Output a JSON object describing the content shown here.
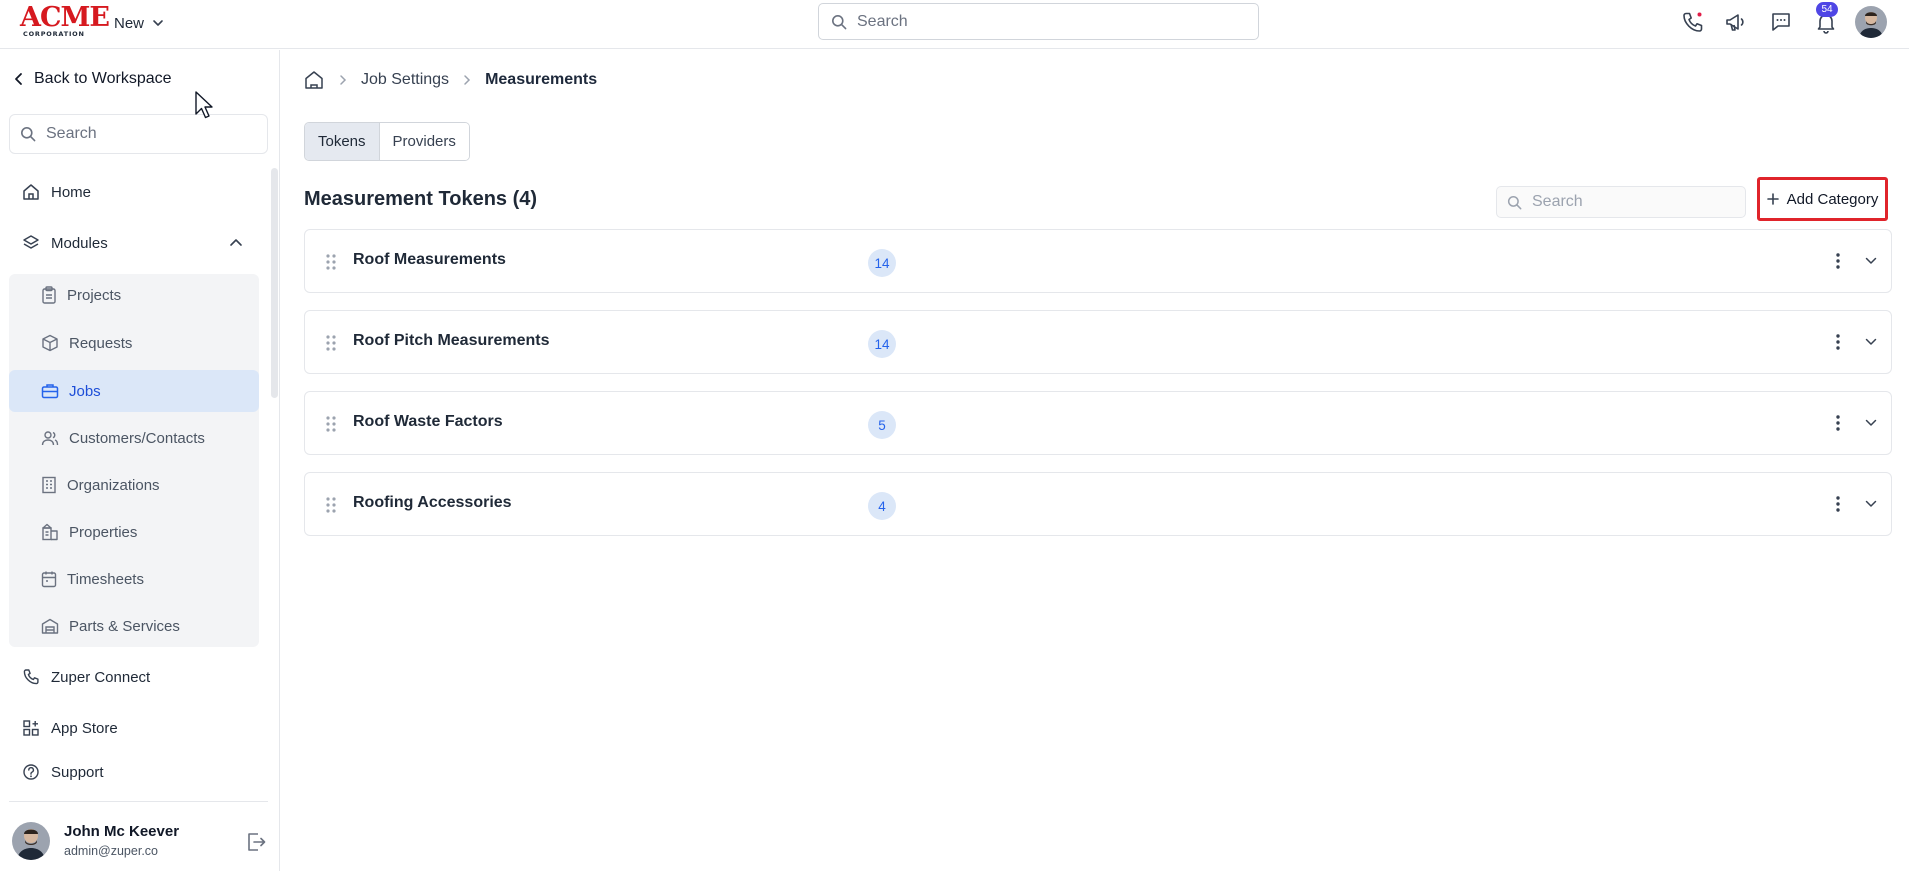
{
  "colors": {
    "accent": "#2563eb",
    "brand_red": "#d6191f",
    "highlight_border": "#e0242b",
    "active_bg": "#dbe7f8",
    "notification_badge": "#4f46e5"
  },
  "topbar": {
    "logo": {
      "word": "ACME",
      "sub": "CORPORATION"
    },
    "new_label": "New",
    "search_placeholder": "Search",
    "icons": [
      "phone-icon",
      "megaphone-icon",
      "chat-icon",
      "bell-icon"
    ],
    "notification_count": "54"
  },
  "sidebar": {
    "back_label": "Back to Workspace",
    "search_placeholder": "Search",
    "home_label": "Home",
    "modules_label": "Modules",
    "module_items": [
      {
        "label": "Projects",
        "icon": "clipboard-icon"
      },
      {
        "label": "Requests",
        "icon": "package-icon"
      },
      {
        "label": "Jobs",
        "icon": "briefcase-icon",
        "active": true
      },
      {
        "label": "Customers/Contacts",
        "icon": "users-icon"
      },
      {
        "label": "Organizations",
        "icon": "building-icon"
      },
      {
        "label": "Properties",
        "icon": "buildings-icon"
      },
      {
        "label": "Timesheets",
        "icon": "calendar-icon"
      },
      {
        "label": "Parts & Services",
        "icon": "warehouse-icon"
      }
    ],
    "connect_label": "Zuper Connect",
    "appstore_label": "App Store",
    "support_label": "Support",
    "user": {
      "name": "John Mc Keever",
      "email": "admin@zuper.co"
    }
  },
  "main": {
    "breadcrumb": {
      "parent": "Job Settings",
      "current": "Measurements"
    },
    "tabs": [
      {
        "label": "Tokens",
        "active": true
      },
      {
        "label": "Providers",
        "active": false
      }
    ],
    "title": "Measurement Tokens (4)",
    "search_placeholder": "Search",
    "add_category_label": "Add Category",
    "categories": [
      {
        "label": "Roof Measurements",
        "count": "14"
      },
      {
        "label": "Roof Pitch Measurements",
        "count": "14"
      },
      {
        "label": "Roof Waste Factors",
        "count": "5"
      },
      {
        "label": "Roofing Accessories",
        "count": "4"
      }
    ]
  }
}
